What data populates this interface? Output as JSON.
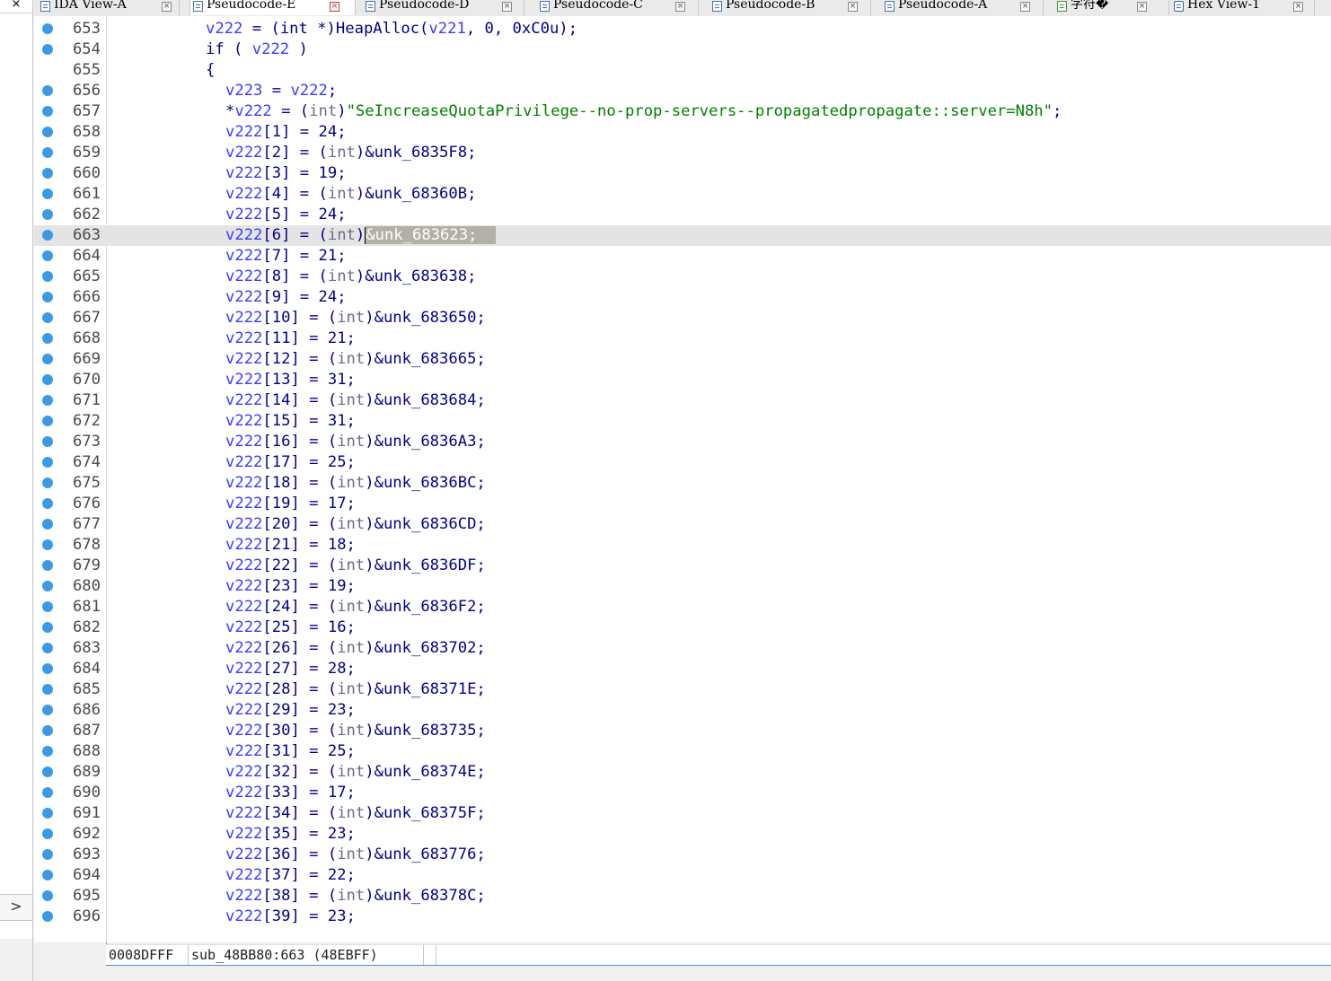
{
  "tabs": [
    {
      "label": "IDA View-A",
      "active": false,
      "icon": "ida-view-icon"
    },
    {
      "label": "Pseudocode-E",
      "active": true,
      "icon": "pseudocode-icon"
    },
    {
      "label": "Pseudocode-D",
      "active": false,
      "icon": "pseudocode-icon"
    },
    {
      "label": "Pseudocode-C",
      "active": false,
      "icon": "pseudocode-icon"
    },
    {
      "label": "Pseudocode-B",
      "active": false,
      "icon": "pseudocode-icon"
    },
    {
      "label": "Pseudocode-A",
      "active": false,
      "icon": "pseudocode-icon"
    },
    {
      "label": "字符�",
      "active": false,
      "icon": "strings-icon"
    },
    {
      "label": "Hex View-1",
      "active": false,
      "icon": "hex-view-icon"
    }
  ],
  "left_strip": {
    "close_glyph": "×",
    "expand_glyph": ">"
  },
  "current_line": 663,
  "lines": [
    {
      "n": "653",
      "bp": true,
      "tokens": [
        [
          "v",
          "v222"
        ],
        [
          "s",
          " = ("
        ],
        [
          "k",
          "int"
        ],
        [
          "s",
          " *)"
        ],
        [
          "k",
          "HeapAlloc"
        ],
        [
          "s",
          "("
        ],
        [
          "v",
          "v221"
        ],
        [
          "s",
          ", 0, 0xC0u);"
        ]
      ],
      "indent": 0
    },
    {
      "n": "654",
      "bp": true,
      "tokens": [
        [
          "k",
          "if"
        ],
        [
          "s",
          " ( "
        ],
        [
          "v",
          "v222"
        ],
        [
          "s",
          " )"
        ]
      ],
      "indent": 0
    },
    {
      "n": "655",
      "bp": false,
      "tokens": [
        [
          "s",
          "{"
        ]
      ],
      "indent": 0
    },
    {
      "n": "656",
      "bp": true,
      "tokens": [
        [
          "v",
          "v223"
        ],
        [
          "s",
          " = "
        ],
        [
          "v",
          "v222"
        ],
        [
          "s",
          ";"
        ]
      ],
      "indent": 1
    },
    {
      "n": "657",
      "bp": true,
      "tokens": [
        [
          "s",
          "*"
        ],
        [
          "v",
          "v222"
        ],
        [
          "s",
          " = ("
        ],
        [
          "t",
          "int"
        ],
        [
          "s",
          ")"
        ],
        [
          "q",
          "\"SeIncreaseQuotaPrivilege--no-prop-servers--propagatedpropagate::server=N8h\""
        ],
        [
          "s",
          ";"
        ]
      ],
      "indent": 1
    },
    {
      "n": "658",
      "bp": true,
      "tokens": [
        [
          "v",
          "v222"
        ],
        [
          "s",
          "[1] = 24;"
        ]
      ],
      "indent": 1
    },
    {
      "n": "659",
      "bp": true,
      "tokens": [
        [
          "v",
          "v222"
        ],
        [
          "s",
          "[2] = ("
        ],
        [
          "t",
          "int"
        ],
        [
          "s",
          ")&unk_6835F8;"
        ]
      ],
      "indent": 1
    },
    {
      "n": "660",
      "bp": true,
      "tokens": [
        [
          "v",
          "v222"
        ],
        [
          "s",
          "[3] = 19;"
        ]
      ],
      "indent": 1
    },
    {
      "n": "661",
      "bp": true,
      "tokens": [
        [
          "v",
          "v222"
        ],
        [
          "s",
          "[4] = ("
        ],
        [
          "t",
          "int"
        ],
        [
          "s",
          ")&unk_68360B;"
        ]
      ],
      "indent": 1
    },
    {
      "n": "662",
      "bp": true,
      "tokens": [
        [
          "v",
          "v222"
        ],
        [
          "s",
          "[5] = 24;"
        ]
      ],
      "indent": 1
    },
    {
      "n": "663",
      "bp": true,
      "tokens": [
        [
          "v",
          "v222"
        ],
        [
          "s",
          "[6] = ("
        ],
        [
          "t",
          "int"
        ],
        [
          "s",
          ")"
        ],
        [
          "c",
          ""
        ],
        [
          "x",
          "&unk_683623;  "
        ]
      ],
      "indent": 1
    },
    {
      "n": "664",
      "bp": true,
      "tokens": [
        [
          "v",
          "v222"
        ],
        [
          "s",
          "[7] = 21;"
        ]
      ],
      "indent": 1
    },
    {
      "n": "665",
      "bp": true,
      "tokens": [
        [
          "v",
          "v222"
        ],
        [
          "s",
          "[8] = ("
        ],
        [
          "t",
          "int"
        ],
        [
          "s",
          ")&unk_683638;"
        ]
      ],
      "indent": 1
    },
    {
      "n": "666",
      "bp": true,
      "tokens": [
        [
          "v",
          "v222"
        ],
        [
          "s",
          "[9] = 24;"
        ]
      ],
      "indent": 1
    },
    {
      "n": "667",
      "bp": true,
      "tokens": [
        [
          "v",
          "v222"
        ],
        [
          "s",
          "[10] = ("
        ],
        [
          "t",
          "int"
        ],
        [
          "s",
          ")&unk_683650;"
        ]
      ],
      "indent": 1
    },
    {
      "n": "668",
      "bp": true,
      "tokens": [
        [
          "v",
          "v222"
        ],
        [
          "s",
          "[11] = 21;"
        ]
      ],
      "indent": 1
    },
    {
      "n": "669",
      "bp": true,
      "tokens": [
        [
          "v",
          "v222"
        ],
        [
          "s",
          "[12] = ("
        ],
        [
          "t",
          "int"
        ],
        [
          "s",
          ")&unk_683665;"
        ]
      ],
      "indent": 1
    },
    {
      "n": "670",
      "bp": true,
      "tokens": [
        [
          "v",
          "v222"
        ],
        [
          "s",
          "[13] = 31;"
        ]
      ],
      "indent": 1
    },
    {
      "n": "671",
      "bp": true,
      "tokens": [
        [
          "v",
          "v222"
        ],
        [
          "s",
          "[14] = ("
        ],
        [
          "t",
          "int"
        ],
        [
          "s",
          ")&unk_683684;"
        ]
      ],
      "indent": 1
    },
    {
      "n": "672",
      "bp": true,
      "tokens": [
        [
          "v",
          "v222"
        ],
        [
          "s",
          "[15] = 31;"
        ]
      ],
      "indent": 1
    },
    {
      "n": "673",
      "bp": true,
      "tokens": [
        [
          "v",
          "v222"
        ],
        [
          "s",
          "[16] = ("
        ],
        [
          "t",
          "int"
        ],
        [
          "s",
          ")&unk_6836A3;"
        ]
      ],
      "indent": 1
    },
    {
      "n": "674",
      "bp": true,
      "tokens": [
        [
          "v",
          "v222"
        ],
        [
          "s",
          "[17] = 25;"
        ]
      ],
      "indent": 1
    },
    {
      "n": "675",
      "bp": true,
      "tokens": [
        [
          "v",
          "v222"
        ],
        [
          "s",
          "[18] = ("
        ],
        [
          "t",
          "int"
        ],
        [
          "s",
          ")&unk_6836BC;"
        ]
      ],
      "indent": 1
    },
    {
      "n": "676",
      "bp": true,
      "tokens": [
        [
          "v",
          "v222"
        ],
        [
          "s",
          "[19] = 17;"
        ]
      ],
      "indent": 1
    },
    {
      "n": "677",
      "bp": true,
      "tokens": [
        [
          "v",
          "v222"
        ],
        [
          "s",
          "[20] = ("
        ],
        [
          "t",
          "int"
        ],
        [
          "s",
          ")&unk_6836CD;"
        ]
      ],
      "indent": 1
    },
    {
      "n": "678",
      "bp": true,
      "tokens": [
        [
          "v",
          "v222"
        ],
        [
          "s",
          "[21] = 18;"
        ]
      ],
      "indent": 1
    },
    {
      "n": "679",
      "bp": true,
      "tokens": [
        [
          "v",
          "v222"
        ],
        [
          "s",
          "[22] = ("
        ],
        [
          "t",
          "int"
        ],
        [
          "s",
          ")&unk_6836DF;"
        ]
      ],
      "indent": 1
    },
    {
      "n": "680",
      "bp": true,
      "tokens": [
        [
          "v",
          "v222"
        ],
        [
          "s",
          "[23] = 19;"
        ]
      ],
      "indent": 1
    },
    {
      "n": "681",
      "bp": true,
      "tokens": [
        [
          "v",
          "v222"
        ],
        [
          "s",
          "[24] = ("
        ],
        [
          "t",
          "int"
        ],
        [
          "s",
          ")&unk_6836F2;"
        ]
      ],
      "indent": 1
    },
    {
      "n": "682",
      "bp": true,
      "tokens": [
        [
          "v",
          "v222"
        ],
        [
          "s",
          "[25] = 16;"
        ]
      ],
      "indent": 1
    },
    {
      "n": "683",
      "bp": true,
      "tokens": [
        [
          "v",
          "v222"
        ],
        [
          "s",
          "[26] = ("
        ],
        [
          "t",
          "int"
        ],
        [
          "s",
          ")&unk_683702;"
        ]
      ],
      "indent": 1
    },
    {
      "n": "684",
      "bp": true,
      "tokens": [
        [
          "v",
          "v222"
        ],
        [
          "s",
          "[27] = 28;"
        ]
      ],
      "indent": 1
    },
    {
      "n": "685",
      "bp": true,
      "tokens": [
        [
          "v",
          "v222"
        ],
        [
          "s",
          "[28] = ("
        ],
        [
          "t",
          "int"
        ],
        [
          "s",
          ")&unk_68371E;"
        ]
      ],
      "indent": 1
    },
    {
      "n": "686",
      "bp": true,
      "tokens": [
        [
          "v",
          "v222"
        ],
        [
          "s",
          "[29] = 23;"
        ]
      ],
      "indent": 1
    },
    {
      "n": "687",
      "bp": true,
      "tokens": [
        [
          "v",
          "v222"
        ],
        [
          "s",
          "[30] = ("
        ],
        [
          "t",
          "int"
        ],
        [
          "s",
          ")&unk_683735;"
        ]
      ],
      "indent": 1
    },
    {
      "n": "688",
      "bp": true,
      "tokens": [
        [
          "v",
          "v222"
        ],
        [
          "s",
          "[31] = 25;"
        ]
      ],
      "indent": 1
    },
    {
      "n": "689",
      "bp": true,
      "tokens": [
        [
          "v",
          "v222"
        ],
        [
          "s",
          "[32] = ("
        ],
        [
          "t",
          "int"
        ],
        [
          "s",
          ")&unk_68374E;"
        ]
      ],
      "indent": 1
    },
    {
      "n": "690",
      "bp": true,
      "tokens": [
        [
          "v",
          "v222"
        ],
        [
          "s",
          "[33] = 17;"
        ]
      ],
      "indent": 1
    },
    {
      "n": "691",
      "bp": true,
      "tokens": [
        [
          "v",
          "v222"
        ],
        [
          "s",
          "[34] = ("
        ],
        [
          "t",
          "int"
        ],
        [
          "s",
          ")&unk_68375F;"
        ]
      ],
      "indent": 1
    },
    {
      "n": "692",
      "bp": true,
      "tokens": [
        [
          "v",
          "v222"
        ],
        [
          "s",
          "[35] = 23;"
        ]
      ],
      "indent": 1
    },
    {
      "n": "693",
      "bp": true,
      "tokens": [
        [
          "v",
          "v222"
        ],
        [
          "s",
          "[36] = ("
        ],
        [
          "t",
          "int"
        ],
        [
          "s",
          ")&unk_683776;"
        ]
      ],
      "indent": 1
    },
    {
      "n": "694",
      "bp": true,
      "tokens": [
        [
          "v",
          "v222"
        ],
        [
          "s",
          "[37] = 22;"
        ]
      ],
      "indent": 1
    },
    {
      "n": "695",
      "bp": true,
      "tokens": [
        [
          "v",
          "v222"
        ],
        [
          "s",
          "[38] = ("
        ],
        [
          "t",
          "int"
        ],
        [
          "s",
          ")&unk_68378C;"
        ]
      ],
      "indent": 1
    },
    {
      "n": "696",
      "bp": true,
      "tokens": [
        [
          "v",
          "v222"
        ],
        [
          "s",
          "[39] = 23;"
        ]
      ],
      "indent": 1
    }
  ],
  "status": {
    "offset": "0008DFFF",
    "location": "sub_48BB80:663",
    "address": "(48EBFF)"
  },
  "colors": {
    "breakpoint": "#3b9ae6",
    "variable": "#3a3aff",
    "keyword": "#00008b",
    "string": "#008000",
    "type": "#6b6b8a",
    "selection": "#b4b0a8",
    "current_line": "#e4e4e4"
  }
}
